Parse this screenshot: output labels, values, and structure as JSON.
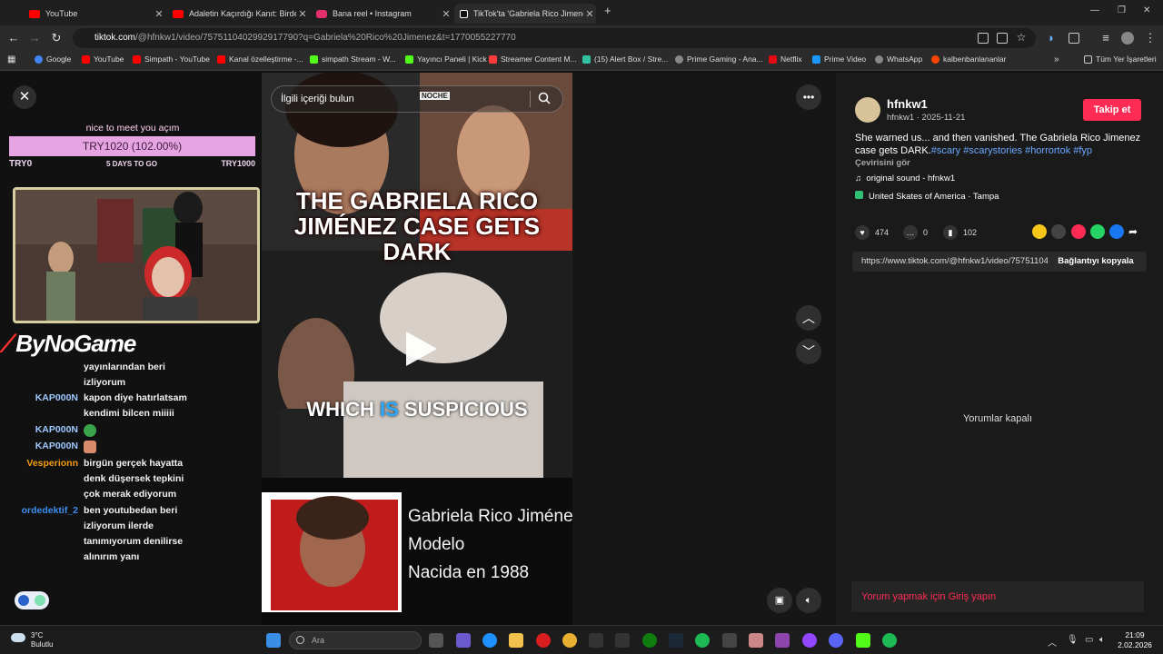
{
  "tabs": [
    {
      "title": "YouTube",
      "color": "#ff0000"
    },
    {
      "title": "Adaletin Kaçırdığı Kanıt: Birden",
      "color": "#ff0000"
    },
    {
      "title": "Bana reel • Instagram",
      "color": "#e1306c"
    },
    {
      "title": "TikTok'ta 'Gabriela Rico Jimenez",
      "color": "#111111"
    }
  ],
  "address": {
    "domain": "tiktok.com",
    "path": "/@hfnkw1/video/7575110402992917790?q=Gabriela%20Rico%20Jimenez&t=1770055227770"
  },
  "bookmarks": [
    {
      "label": "Google",
      "color": "#4285f4"
    },
    {
      "label": "YouTube",
      "color": "#ff0000"
    },
    {
      "label": "Simpath - YouTube",
      "color": "#ff0000"
    },
    {
      "label": "Kanal özelleştirme -...",
      "color": "#ff0000"
    },
    {
      "label": "simpath Stream - W...",
      "color": "#53fc18"
    },
    {
      "label": "Yayıncı Paneli | Kick",
      "color": "#53fc18"
    },
    {
      "label": "Streamer Content M...",
      "color": "#ff3b3b"
    },
    {
      "label": "(15) Alert Box / Stre...",
      "color": "#31c3a2"
    },
    {
      "label": "Prime Gaming - Ana...",
      "color": "#888888"
    },
    {
      "label": "Netflix",
      "color": "#e50914"
    },
    {
      "label": "Prime Video",
      "color": "#1a98ff"
    },
    {
      "label": "WhatsApp",
      "color": "#888888"
    },
    {
      "label": "kalbenbanlananlar",
      "color": "#ff4500"
    }
  ],
  "bookmarks_other": "Tüm Yer İşaretleri",
  "overlay": {
    "goal_title": "nice to meet you açım",
    "goal_bar": "TRY1020 (102.00%)",
    "goal_left": "TRY0",
    "goal_mid": "5 DAYS TO GO",
    "goal_right": "TRY1000",
    "brand": "ByNoGame"
  },
  "chat": [
    {
      "user": "",
      "user_color": "#ffffff",
      "lines": [
        "yayınlarından beri",
        "izliyorum"
      ]
    },
    {
      "user": "KAP000N",
      "user_color": "#9ec8ff",
      "lines": [
        "kapon diye hatırlatsam",
        "kendimi bilcen miiiii"
      ]
    },
    {
      "user": "KAP000N",
      "user_color": "#9ec8ff",
      "lines": [
        ""
      ]
    },
    {
      "user": "KAP000N",
      "user_color": "#9ec8ff",
      "lines": [
        ""
      ]
    },
    {
      "user": "Vesperionn",
      "user_color": "#f39c12",
      "lines": [
        "birgün gerçek hayatta",
        "denk düşersek tepkini",
        "çok merak ediyorum"
      ]
    },
    {
      "user": "ordedektif_2",
      "user_color": "#3d8ef0",
      "lines": [
        "ben youtubedan beri",
        "izliyorum ilerde",
        "tanımıyorum denilirse",
        "alınırım yanı"
      ]
    }
  ],
  "video": {
    "search_placeholder": "İlgili içeriği bulun",
    "caption_lines": [
      "THE GABRIELA RICO",
      "JIMÉNEZ CASE GETS",
      "DARK"
    ],
    "sub_pre": "WHICH ",
    "sub_hl": "IS",
    "sub_post": " SUSPICIOUS",
    "name_lines": [
      "Gabriela Rico Jiménez",
      "Modelo",
      "Nacida en 1988"
    ],
    "small_label": "NOCHE"
  },
  "post": {
    "username": "hfnkw1",
    "sub": "hfnkw1 · 2025-11-21",
    "follow": "Takip et",
    "desc": "She warned us... and then vanished. The Gabriela Rico Jimenez case gets DARK.",
    "tags": "#scary #scarystories #horrortok #fyp",
    "translate": "Çevirisini gör",
    "sound": "original sound - hfnkw1",
    "location": "United Skates of America · Tampa",
    "likes": "474",
    "comments": "0",
    "saves": "102",
    "link": "https://www.tiktok.com/@hfnkw1/video/757511040299...",
    "copy_link": "Bağlantıyı kopyala",
    "no_comments": "Yorumlar kapalı",
    "login_prompt": "Yorum yapmak için Giriş yapın"
  },
  "taskbar": {
    "temp": "3°C",
    "weather": "Bulutlu",
    "search": "Ara",
    "time": "21:09",
    "date": "2.02.2026"
  },
  "colors": {
    "accent": "#fe2c55",
    "goal": "#e7a4e3"
  }
}
